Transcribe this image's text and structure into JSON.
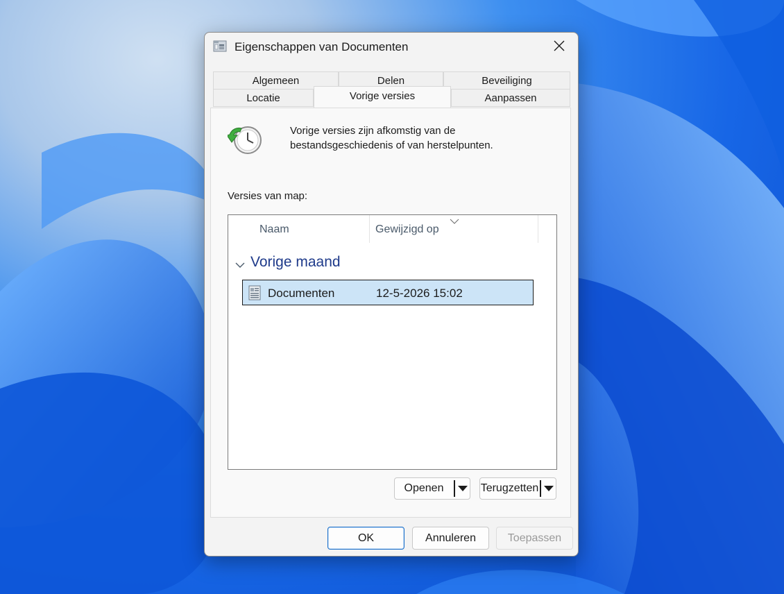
{
  "window": {
    "title": "Eigenschappen van Documenten",
    "icon": "folder-properties-icon"
  },
  "tabs": {
    "row1": [
      {
        "label": "Algemeen"
      },
      {
        "label": "Delen"
      },
      {
        "label": "Beveiliging"
      }
    ],
    "row2": [
      {
        "label": "Locatie"
      },
      {
        "label": "Vorige versies",
        "active": true
      },
      {
        "label": "Aanpassen"
      }
    ]
  },
  "previous_versions": {
    "info_line1": "Vorige versies zijn afkomstig van de",
    "info_line2": "bestandsgeschiedenis of van herstelpunten.",
    "versions_label": "Versies van map:",
    "columns": {
      "name": "Naam",
      "modified": "Gewijzigd op"
    },
    "group": "Vorige maand",
    "rows": [
      {
        "name": "Documenten",
        "modified": "12-5-2026 15:02",
        "selected": true
      }
    ],
    "open_button": "Openen",
    "restore_button": "Terugzetten"
  },
  "footer": {
    "ok": "OK",
    "cancel": "Annuleren",
    "apply": "Toepassen"
  },
  "colors": {
    "selection": "#cce4f7",
    "group_header": "#1e3a8a",
    "accent": "#1a6fc9"
  }
}
